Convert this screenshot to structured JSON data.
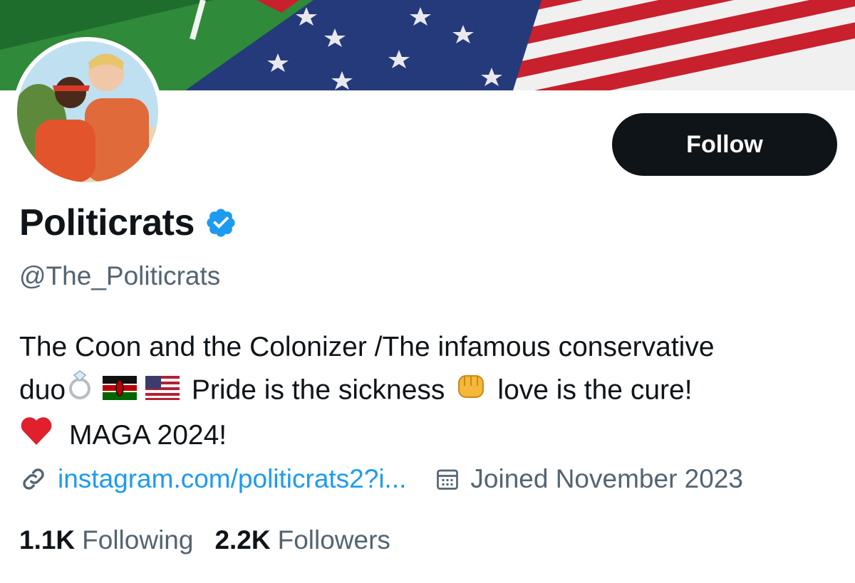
{
  "profile": {
    "display_name": "Politicrats",
    "handle": "@The_Politicrats",
    "verified": true,
    "bio": {
      "line1": "The Coon and the Colonizer /The infamous conservative",
      "line2_start": "duo",
      "line2_mid": "Pride is the sickness",
      "line2_end": "love is the cure!",
      "line3_end": "MAGA 2024!"
    },
    "bio_emojis": [
      "ring-icon",
      "kenya-flag-icon",
      "us-flag-icon",
      "raised-fist-icon",
      "red-heart-icon"
    ],
    "website": "instagram.com/politicrats2?i...",
    "joined": "Joined November 2023"
  },
  "actions": {
    "follow_label": "Follow"
  },
  "stats": {
    "following_count": "1.1K",
    "following_label": "Following",
    "followers_count": "2.2K",
    "followers_label": "Followers"
  },
  "colors": {
    "accent": "#1d9bf0",
    "text_primary": "#0f1419",
    "text_secondary": "#536471",
    "button_bg": "#0f1419"
  }
}
